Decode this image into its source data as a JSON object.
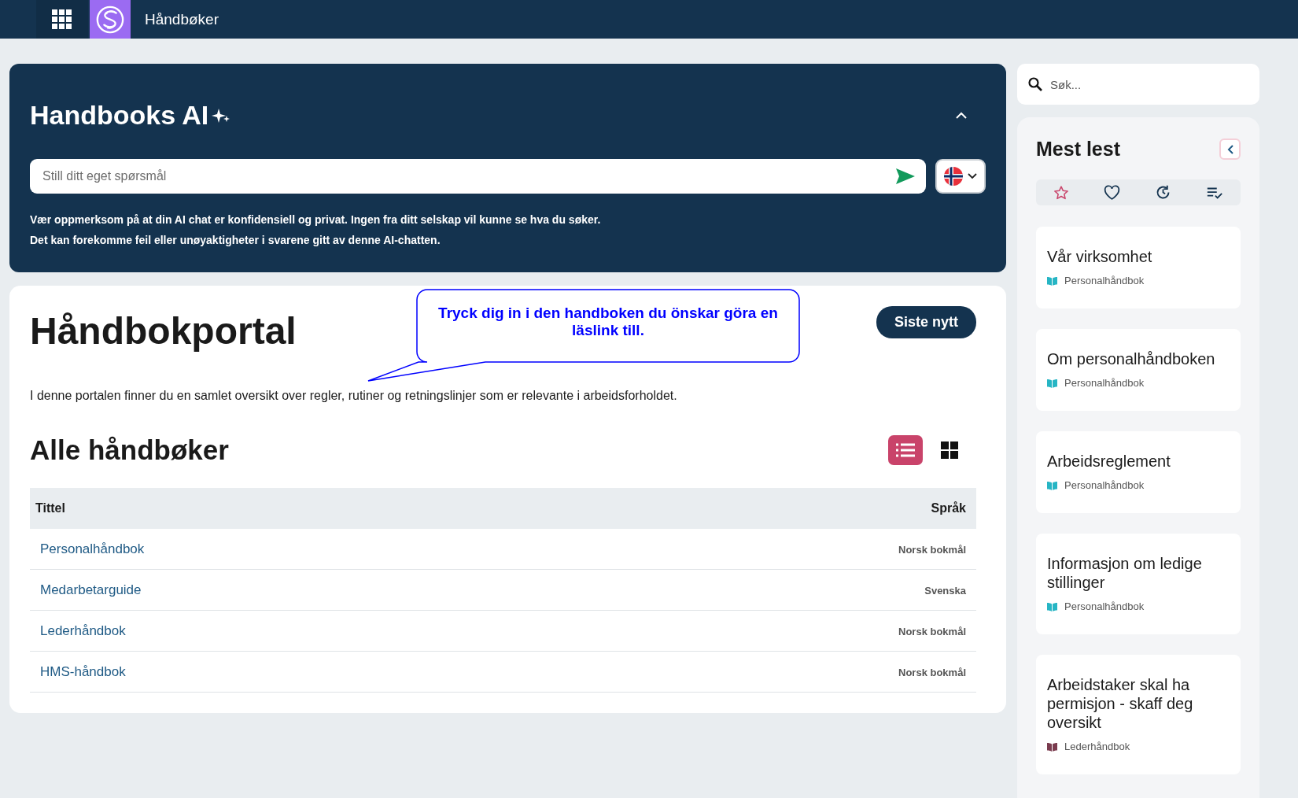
{
  "top_bar": {
    "title": "Håndbøker"
  },
  "ai_panel": {
    "title": "Handbooks AI",
    "input": {
      "placeholder": "Still ditt eget spørsmål"
    },
    "notice_lines": [
      "Vær oppmerksom på at din AI chat er konfidensiell og privat. Ingen fra ditt selskap vil kunne se hva du søker.",
      "Det kan forekomme feil eller unøyaktigheter i svarene gitt av denne AI-chatten."
    ]
  },
  "portal": {
    "title": "Håndbokportal",
    "news_button": "Siste nytt",
    "description": "I denne portalen finner du en samlet oversikt over regler, rutiner og retningslinjer som er relevante i arbeidsforholdet.",
    "callout": "Tryck dig in i den handboken du önskar göra en läslink till.",
    "section_title": "Alle håndbøker",
    "views": [
      {
        "kind": "list",
        "selected": true
      },
      {
        "kind": "grid",
        "selected": false
      }
    ],
    "table": {
      "columns": [
        "Tittel",
        "Språk"
      ],
      "rows": [
        {
          "title": "Personalhåndbok",
          "language": "Norsk bokmål"
        },
        {
          "title": "Medarbetarguide",
          "language": "Svenska"
        },
        {
          "title": "Lederhåndbok",
          "language": "Norsk bokmål"
        },
        {
          "title": "HMS-håndbok",
          "language": "Norsk bokmål"
        }
      ]
    }
  },
  "search": {
    "placeholder": "Søk..."
  },
  "most_read": {
    "title": "Mest lest",
    "tabs": [
      {
        "kind": "star",
        "selected": true
      },
      {
        "kind": "heart",
        "selected": false
      },
      {
        "kind": "history",
        "selected": false
      },
      {
        "kind": "checklist",
        "selected": false
      }
    ],
    "items": [
      {
        "title": "Vår virksomhet",
        "book": "Personalhåndbok",
        "color": "#26b5c4"
      },
      {
        "title": "Om personalhåndboken",
        "book": "Personalhåndbok",
        "color": "#26b5c4"
      },
      {
        "title": "Arbeidsreglement",
        "book": "Personalhåndbok",
        "color": "#26b5c4"
      },
      {
        "title": "Informasjon om ledige stillinger",
        "book": "Personalhåndbok",
        "color": "#26b5c4"
      },
      {
        "title": "Arbeidstaker skal ha permisjon - skaff deg oversikt",
        "book": "Lederhåndbok",
        "color": "#7a3b4e"
      }
    ]
  }
}
